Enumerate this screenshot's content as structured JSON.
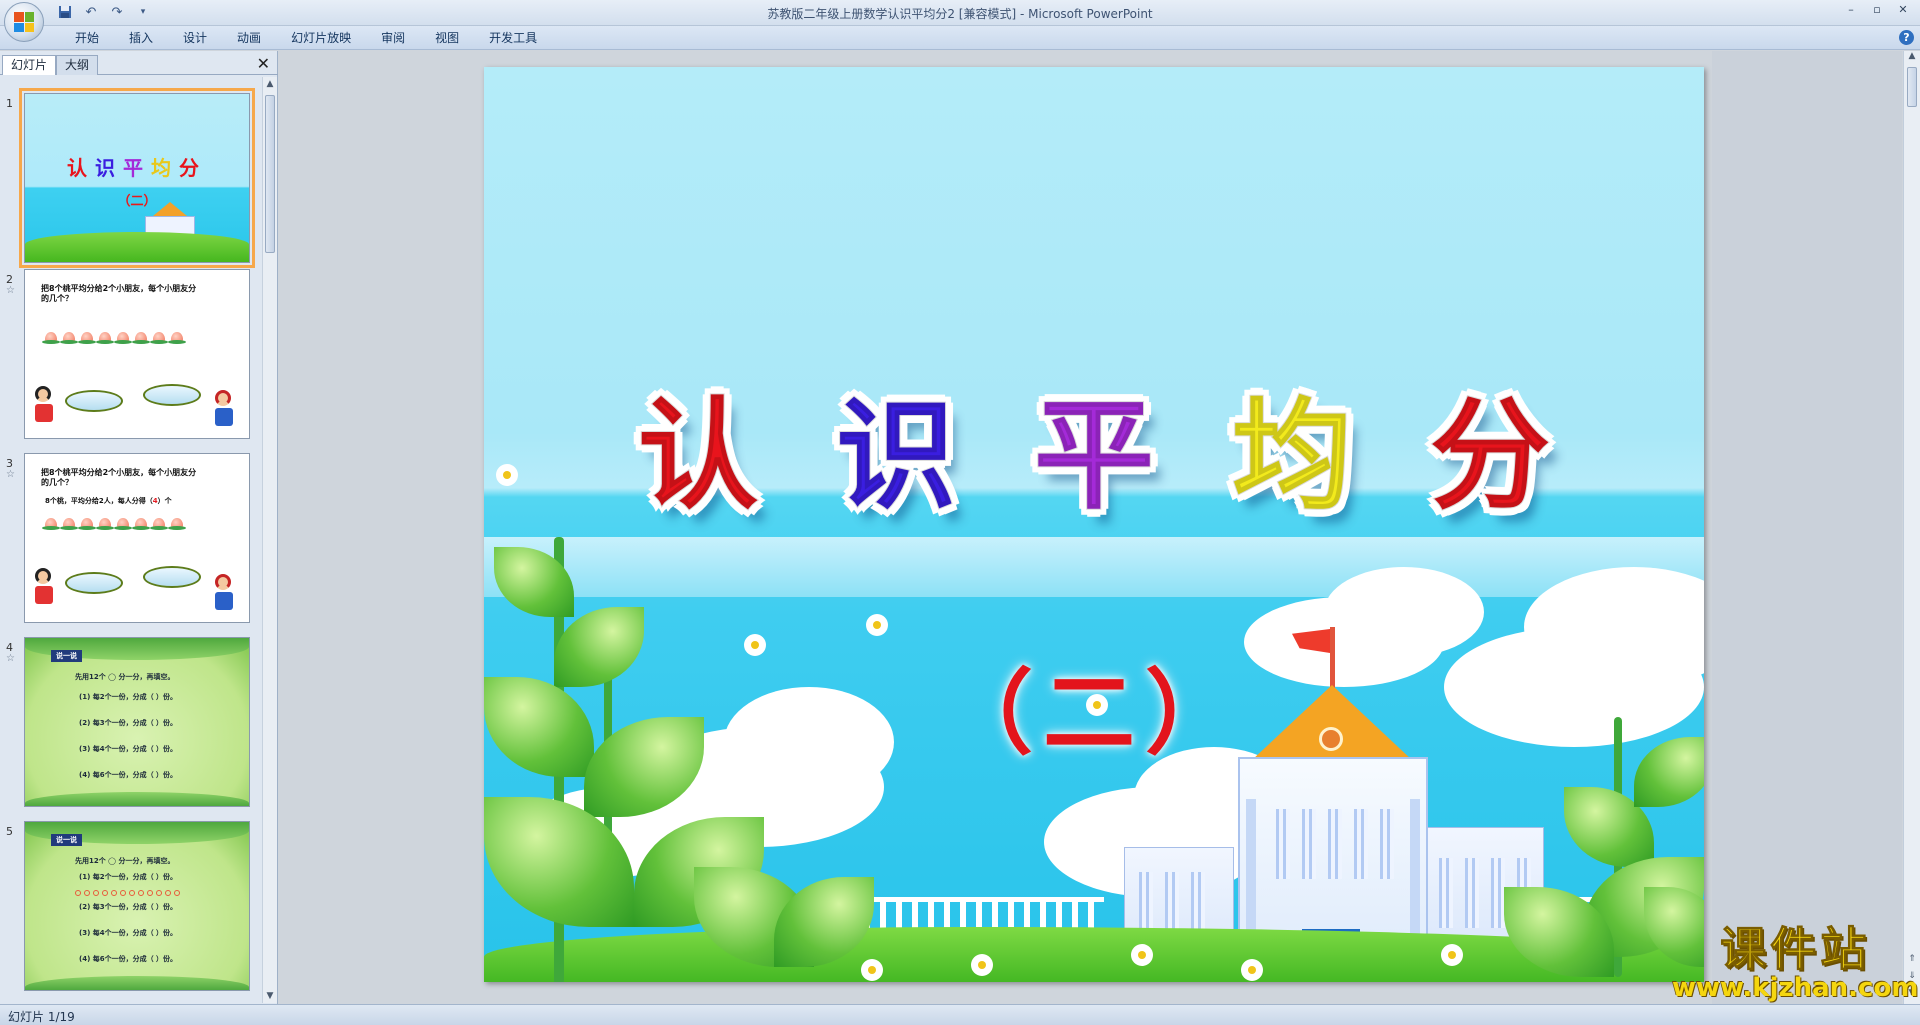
{
  "window": {
    "title": "苏教版二年级上册数学认识平均分2 [兼容模式] - Microsoft PowerPoint"
  },
  "ribbon": {
    "tabs": [
      "开始",
      "插入",
      "设计",
      "动画",
      "幻灯片放映",
      "审阅",
      "视图",
      "开发工具"
    ]
  },
  "pane": {
    "tabs": [
      "幻灯片",
      "大纲"
    ],
    "close": "✕",
    "slides": [
      {
        "num": "1"
      },
      {
        "num": "2",
        "question": "把8个桃平均分给2个小朋友，每个小朋友分的几个？"
      },
      {
        "num": "3",
        "question": "把8个桃平均分给2个小朋友，每个小朋友分的几个？",
        "answer_prefix": "8个桃，平均分给2人，每人分得（",
        "answer_value": "4",
        "answer_suffix": "）个"
      },
      {
        "num": "4",
        "label": "说一说",
        "lines": [
          "先用12个 ◯ 分一分，再填空。",
          "(1) 每2个一份，分成（  ）份。",
          "(2) 每3个一份，分成（  ）份。",
          "(3) 每4个一份，分成（  ）份。",
          "(4) 每6个一份，分成（  ）份。"
        ]
      },
      {
        "num": "5",
        "label": "说一说",
        "lines": [
          "先用12个 ◯ 分一分，再填空。",
          "(1) 每2个一份，分成（  ）份。",
          "(2) 每3个一份，分成（  ）份。",
          "(3) 每4个一份，分成（  ）份。",
          "(4) 每6个一份，分成（  ）份。"
        ]
      }
    ]
  },
  "slide": {
    "title_chars": [
      {
        "char": "认",
        "color": "#e8141c"
      },
      {
        "char": "识",
        "color": "#3a1ee0"
      },
      {
        "char": "平",
        "color": "#a42ad8"
      },
      {
        "char": "均",
        "color": "#f2ea1c"
      },
      {
        "char": "分",
        "color": "#e8141c"
      }
    ],
    "subtitle": "（二）"
  },
  "watermark": {
    "cn": "课件站",
    "url": "www.kjzhan.com"
  },
  "status": {
    "slide_indicator": "幻灯片 1/19"
  },
  "icons": {
    "office_button": "office-logo",
    "save": "save-icon",
    "undo": "undo-icon",
    "redo": "redo-icon",
    "help": "help-icon"
  }
}
